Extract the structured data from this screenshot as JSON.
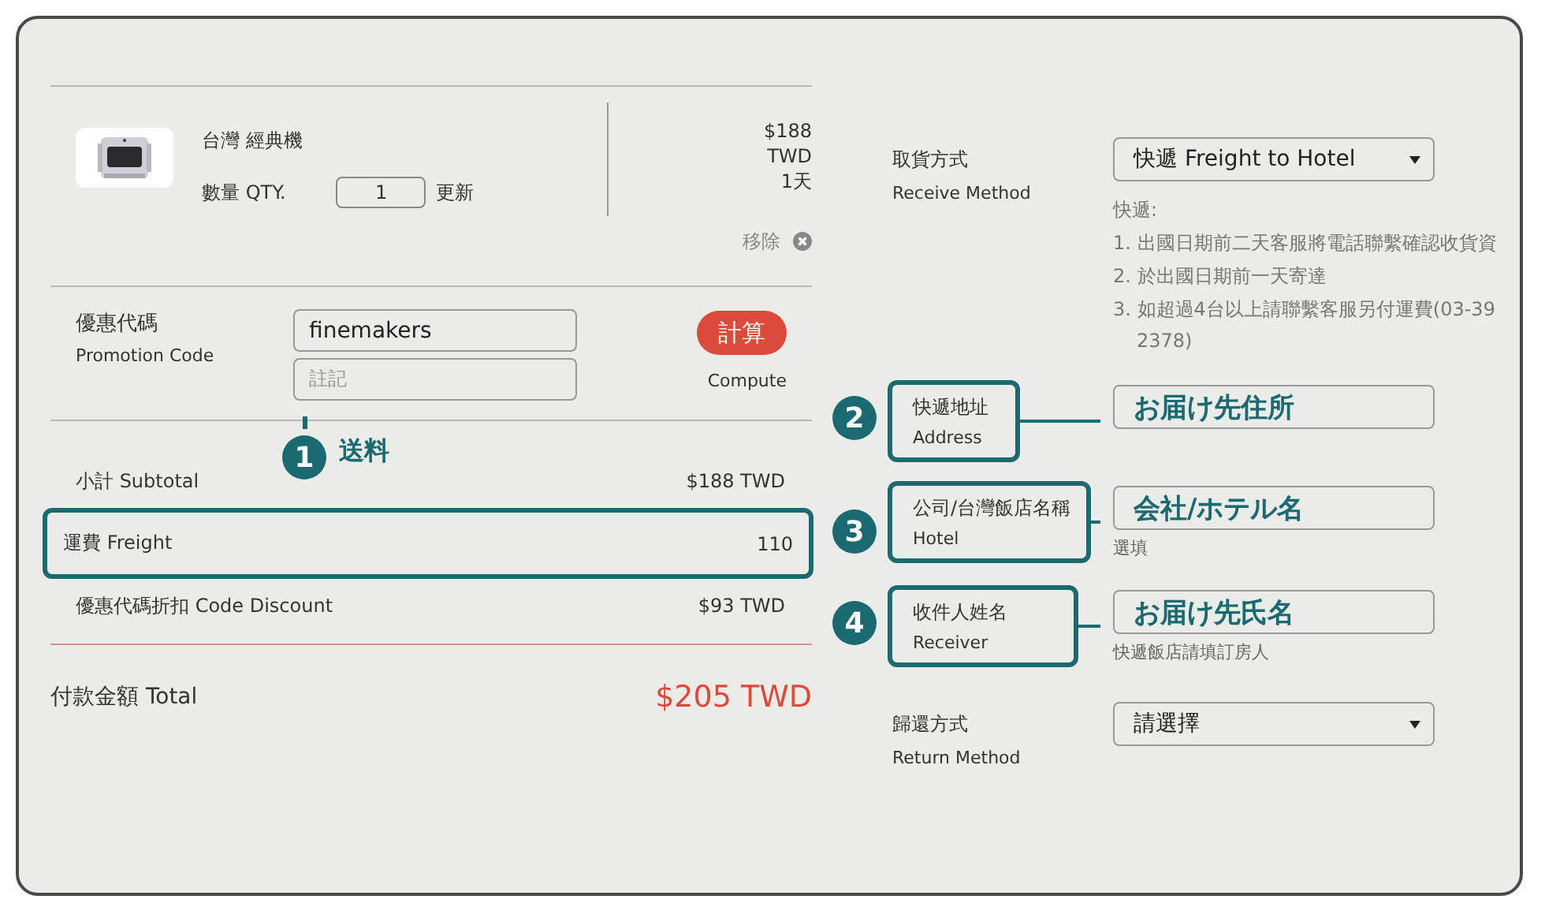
{
  "cart_item": {
    "name": "台灣 經典機",
    "qty_label": "數量 QTY.",
    "qty": "1",
    "update": "更新",
    "price": "$188",
    "currency": "TWD",
    "duration": "1天",
    "remove": "移除"
  },
  "promotion": {
    "label": "優惠代碼",
    "label_en": "Promotion Code",
    "code": "finemakers",
    "note_placeholder": "註記",
    "compute_button": "計算",
    "compute_label": "Compute"
  },
  "callout": {
    "number": "1",
    "text": "送料"
  },
  "summary": [
    {
      "label": "小計 Subtotal",
      "value": "$188 TWD",
      "highlighted": false
    },
    {
      "label": "運費 Freight",
      "value": "110",
      "highlighted": true
    },
    {
      "label": "優惠代碼折扣 Code Discount",
      "value": "$93 TWD",
      "highlighted": false
    }
  ],
  "total": {
    "label": "付款金額 Total",
    "value": "$205 TWD"
  },
  "form": [
    {
      "kind": "select",
      "label": "取貨方式",
      "label_en": "Receive Method",
      "value": "快遞 Freight to Hotel",
      "notes_title": "快遞:",
      "notes": [
        {
          "text": "1. 出國日期前二天客服將電話聯繫確認收貨資"
        },
        {
          "text": "2. 於出國日期前一天寄達"
        },
        {
          "text": "3. 如超過4台以上請聯繫客服另付運費(03-39",
          "continuation": "2378)"
        }
      ]
    },
    {
      "kind": "text",
      "number": "2",
      "label": "快遞地址",
      "label_en": "Address",
      "value": "お届け先住所"
    },
    {
      "kind": "text",
      "number": "3",
      "label": "公司/台灣飯店名稱",
      "label_en": "Hotel",
      "value": "会社/ホテル名",
      "hint": "選填"
    },
    {
      "kind": "text",
      "number": "4",
      "label": "收件人姓名",
      "label_en": "Receiver",
      "value": "お届け先氏名",
      "hint": "快遞飯店請填訂房人"
    },
    {
      "kind": "select",
      "label": "歸還方式",
      "label_en": "Return Method",
      "value": "請選擇"
    }
  ]
}
